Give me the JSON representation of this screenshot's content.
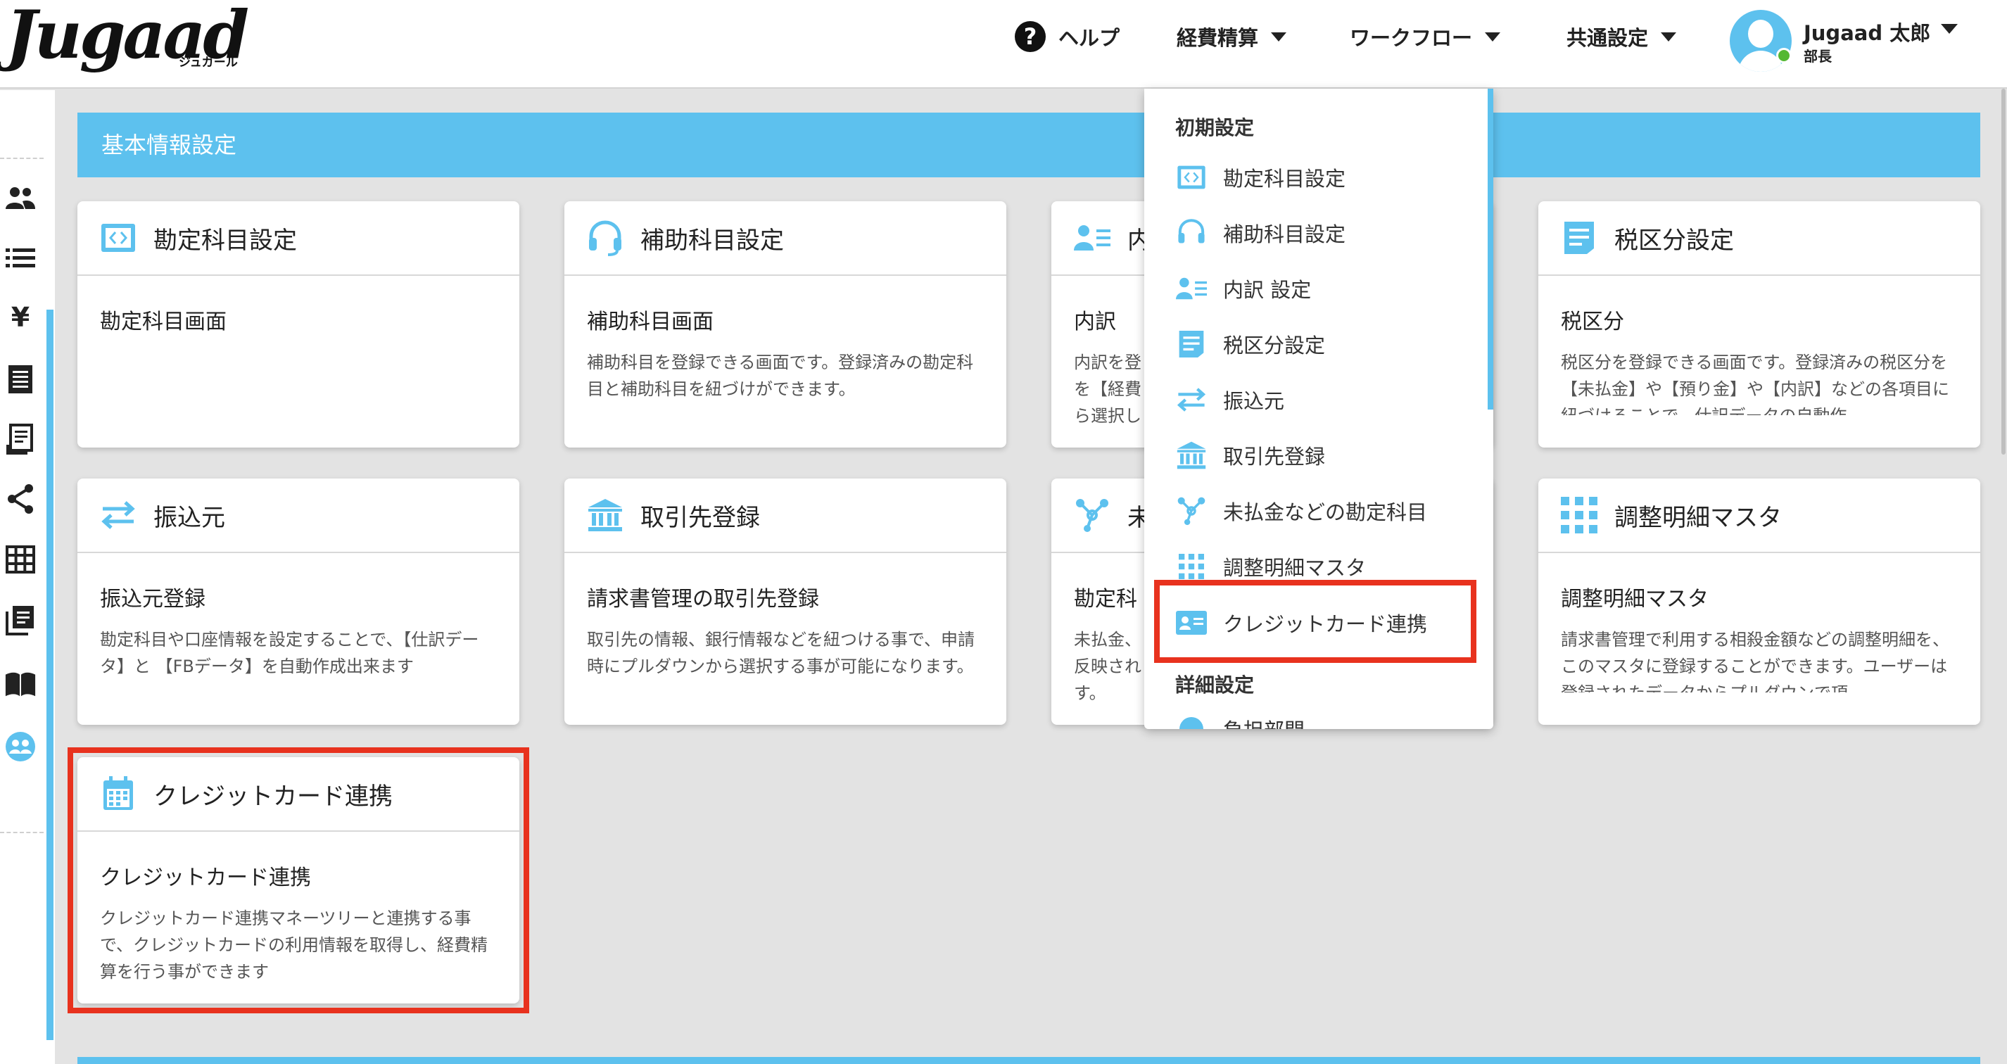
{
  "app": {
    "logo_text": "Jugaad",
    "logo_sub": "ジュガール"
  },
  "header": {
    "help_label": "ヘルプ",
    "menu": [
      "経費精算",
      "ワークフロー",
      "共通設定"
    ],
    "user_name": "Jugaad 太郎",
    "user_role": "部長"
  },
  "sidebar": {
    "icons": [
      "users-icon",
      "list-icon",
      "yen-icon",
      "document-icon",
      "receipt-icon",
      "share-icon",
      "grid-icon",
      "stack-icon",
      "book-icon",
      "people-circle-icon"
    ]
  },
  "section": {
    "title": "基本情報設定"
  },
  "cards": [
    {
      "icon": "code-icon",
      "title": "勘定科目設定",
      "subtitle": "勘定科目画面",
      "desc": ""
    },
    {
      "icon": "headset-icon",
      "title": "補助科目設定",
      "subtitle": "補助科目画面",
      "desc": "補助科目を登録できる画面です。登録済みの勘定科目と補助科目を紐づけができます。"
    },
    {
      "icon": "person-list-icon",
      "title": "内",
      "subtitle": "内訳",
      "desc": "内訳を登\nを【経費\nら選択し"
    },
    {
      "icon": "tax-doc-icon",
      "title": "税区分設定",
      "subtitle": "税区分",
      "desc": "税区分を登録できる画面です。登録済みの税区分を【未払金】や【預り金】や【内訳】などの各項目に紐づけることで、仕訳データの自動作"
    },
    {
      "icon": "transfer-icon",
      "title": "振込元",
      "subtitle": "振込元登録",
      "desc": "勘定科目や口座情報を設定することで、【仕訳データ】と 【FBデータ】を自動作成出来ます"
    },
    {
      "icon": "bank-icon",
      "title": "取引先登録",
      "subtitle": "請求書管理の取引先登録",
      "desc": "取引先の情報、銀行情報などを紐つける事で、申請時にプルダウンから選択する事が可能になります。"
    },
    {
      "icon": "network-icon",
      "title": "未",
      "subtitle": "勘定科",
      "desc": "未払金、\n反映され\nす。"
    },
    {
      "icon": "grid-icon",
      "title": "調整明細マスタ",
      "subtitle": "調整明細マスタ",
      "desc": "請求書管理で利用する相殺金額などの調整明細を、このマスタに登録することができます。ユーザーは登録されたデータからプルダウンで項"
    },
    {
      "icon": "calendar-icon",
      "title": "クレジットカード連携",
      "subtitle": "クレジットカード連携",
      "desc": "クレジットカード連携マネーツリーと連携する事で、クレジットカードの利用情報を取得し、経費精算を行う事ができます"
    }
  ],
  "dropdown": {
    "heading_initial": "初期設定",
    "items": [
      {
        "icon": "code-icon",
        "label": "勘定科目設定"
      },
      {
        "icon": "headset-icon",
        "label": "補助科目設定"
      },
      {
        "icon": "person-list-icon",
        "label": "内訳 設定"
      },
      {
        "icon": "tax-doc-icon",
        "label": "税区分設定"
      },
      {
        "icon": "transfer-icon",
        "label": "振込元"
      },
      {
        "icon": "bank-icon",
        "label": "取引先登録"
      },
      {
        "icon": "network-icon",
        "label": "未払金などの勘定科目"
      },
      {
        "icon": "grid-icon",
        "label": "調整明細マスタ"
      },
      {
        "icon": "id-card-icon",
        "label": "クレジットカード連携"
      }
    ],
    "heading_detail": "詳細設定",
    "partial_item": "負担部門"
  },
  "colors": {
    "accent": "#5dc1ee",
    "highlight": "#e8321e",
    "background": "#e3e3e3"
  }
}
